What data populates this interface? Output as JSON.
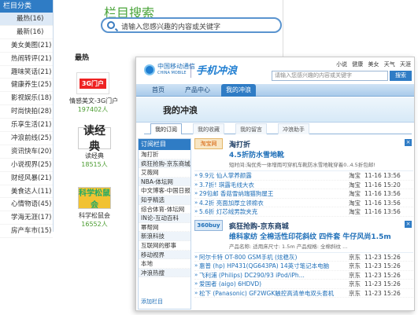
{
  "back": {
    "sidebar_title": "栏目分类",
    "categories": [
      {
        "label": "最热(16)",
        "style": "active"
      },
      {
        "label": "最新(16)",
        "style": "sub"
      },
      {
        "label": "美女美图(21)",
        "style": ""
      },
      {
        "label": "热闹转评(21)",
        "style": ""
      },
      {
        "label": "趣味笑话(21)",
        "style": ""
      },
      {
        "label": "健康养生(25)",
        "style": ""
      },
      {
        "label": "影视娱乐(18)",
        "style": ""
      },
      {
        "label": "时尚快拍(28)",
        "style": ""
      },
      {
        "label": "乐享生活(21)",
        "style": ""
      },
      {
        "label": "冲浪前线(25)",
        "style": ""
      },
      {
        "label": "资讯快车(20)",
        "style": ""
      },
      {
        "label": "小说视界(25)",
        "style": ""
      },
      {
        "label": "财经风暴(21)",
        "style": ""
      },
      {
        "label": "美食达人(11)",
        "style": ""
      },
      {
        "label": "心情物语(45)",
        "style": ""
      },
      {
        "label": "学海无涯(17)",
        "style": ""
      },
      {
        "label": "房产车市(15)",
        "style": ""
      }
    ],
    "search_title": "栏目搜索",
    "search_placeholder": "请输入您感兴趣的内容或关键字",
    "hot_label": "最热",
    "apps": [
      {
        "icon_text": "3G门户",
        "name": "情感美文-3G门户",
        "count": "197402人"
      },
      {
        "icon_text": "读经典",
        "name": "读经典",
        "count": "18515人"
      },
      {
        "icon_text": "科学松鼠会",
        "name": "科学松鼠会",
        "count": "16552人"
      }
    ]
  },
  "front": {
    "logo_zh": "中国移动通信",
    "logo_en": "CHINA MOBILE",
    "logo_product": "手机冲浪",
    "top_links": [
      "小说",
      "健康",
      "美女",
      "天气",
      "天涯"
    ],
    "search_placeholder": "请输入您感兴趣的内容或关键字",
    "search_button": "搜索",
    "nav": [
      "首页",
      "产品中心",
      "我的冲浪"
    ],
    "banner_title": "我的冲浪",
    "tabs": [
      "我的订阅",
      "我的收藏",
      "我的留言",
      "冲浪助手"
    ],
    "left_title": "订阅栏目",
    "left_items": [
      "淘打折",
      "疯狂抢购-京东商城",
      "艾薇网",
      "NBA-体坛网",
      "中文博客-中国日报网",
      "知乎精选",
      "综合体育-体坛网",
      "IN论-互动百科",
      "幂帮网",
      "新浪科技",
      "互联网的那事",
      "移动视界",
      "本地",
      "冲浪热搜"
    ],
    "left_footer": "添加栏目",
    "sec1": {
      "logo": "淘宝网",
      "name": "淘打折",
      "headline": "4.5折防水雪地靴",
      "desc": "短时间:淘优秀一体增雨可穿机车靴防水雪地靴穿着0..4.5折包邮!",
      "rows": [
        {
          "text": "9.9元 仙人掌养颜露",
          "src": "淘宝",
          "time": "11-16 13:56"
        },
        {
          "text": "3.7折! 琪露毛线大衣",
          "src": "淘宝",
          "time": "11-16 15:20"
        },
        {
          "text": "29包邮 香菇雪纳瑞猫狗屋王",
          "src": "淘宝",
          "time": "11-16 13:56"
        },
        {
          "text": "4.2折 亮面加厚立领棉衣",
          "src": "淘宝",
          "time": "11-16 13:56"
        },
        {
          "text": "5.6折 灯芯绒男款夹克",
          "src": "淘宝",
          "time": "11-16 13:56"
        }
      ]
    },
    "sec2": {
      "logo": "360buy",
      "name": "疯狂抢购-京东商城",
      "headline": "维科家纺 全棉活性印花斜纹 四件套 牛仔风尚1.5m",
      "desc": "产品名称: 适用床尺寸: 1.5m 产品规格: 全棉斜纹 ...",
      "rows": [
        {
          "text": "阿尔卡特 OT-800 GSM手机 (炫稳灰)",
          "src": "京东",
          "time": "11-23 15:26"
        },
        {
          "text": "惠普 (hp) HP431(QG643PA) 14英寸笔记本电脑",
          "src": "京东",
          "time": "11-23 15:26"
        },
        {
          "text": "飞利浦 (Philips) DC290/93 iPod/iPh...",
          "src": "京东",
          "time": "11-23 15:26"
        },
        {
          "text": "爱国者 (aigo) 6HDVD)",
          "src": "京东",
          "time": "11-23 15:26"
        },
        {
          "text": "松下 (Panasonic) GF2WGK触控高清单电双头套机",
          "src": "京东",
          "time": "11-23 15:26"
        }
      ]
    }
  }
}
